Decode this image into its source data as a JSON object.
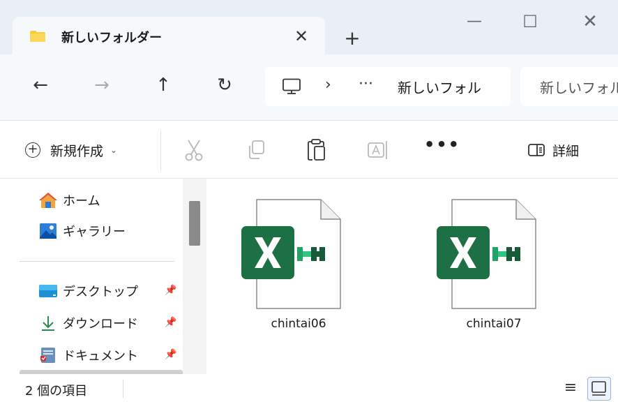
{
  "window": {
    "tab_title": "新しいフォルダー",
    "tab_close": "✕",
    "new_tab": "+",
    "minimize": "—",
    "maximize": "☐",
    "close": "✕"
  },
  "nav": {
    "back": "←",
    "forward": "→",
    "up": "↑",
    "refresh": "↻",
    "address_separator": "›",
    "address_overflow": "···",
    "address_crumb": "新しいフォル",
    "search_text": "新しいフォル"
  },
  "commands": {
    "new_label": "新規作成",
    "new_chevron": "⌄",
    "more": "•••",
    "details_label": "詳細"
  },
  "sidebar": {
    "items": [
      {
        "label": "ホーム",
        "pinned": false
      },
      {
        "label": "ギャラリー",
        "pinned": false
      },
      {
        "label": "デスクトップ",
        "pinned": true
      },
      {
        "label": "ダウンロード",
        "pinned": true
      },
      {
        "label": "ドキュメント",
        "pinned": true
      }
    ],
    "pin_glyph": "📌"
  },
  "files": [
    {
      "name": "chintai06",
      "type": "excel"
    },
    {
      "name": "chintai07",
      "type": "excel"
    }
  ],
  "status": {
    "item_count": "2 個の項目",
    "list_view_glyph": "≡"
  },
  "colors": {
    "excel_green": "#1d7044",
    "excel_dark": "#185c37",
    "folder_yellow": "#f8c93b",
    "titlebar_bg": "#e9eff6",
    "accent": "#0067c0"
  }
}
